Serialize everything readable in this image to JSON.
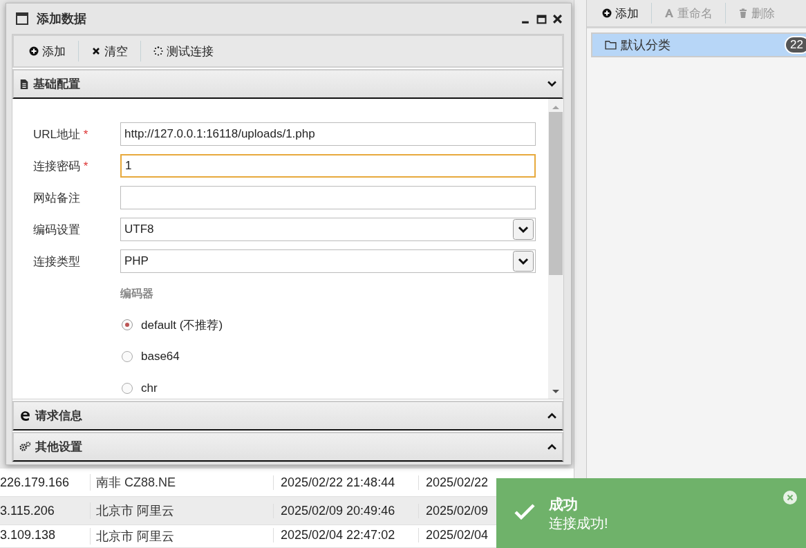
{
  "table": {
    "rows": [
      {
        "ip": "226.179.166",
        "location": "南非 CZ88.NE",
        "created": "2025/02/22 21:48:44",
        "updated": "2025/02/22"
      },
      {
        "ip": "3.115.206",
        "location": "北京市 阿里云",
        "created": "2025/02/09 20:49:46",
        "updated": "2025/02/09"
      },
      {
        "ip": "3.109.138",
        "location": "北京市 阿里云",
        "created": "2025/02/04 22:47:02",
        "updated": "2025/02/04"
      }
    ]
  },
  "sidebar": {
    "toolbar": [
      {
        "label": "添加",
        "disabled": false
      },
      {
        "label": "重命名",
        "disabled": true
      },
      {
        "label": "删除",
        "disabled": true
      }
    ],
    "categories": [
      {
        "label": "默认分类",
        "count": "22",
        "selected": true
      }
    ]
  },
  "dialog": {
    "title": "添加数据",
    "toolbar": [
      {
        "label": "添加"
      },
      {
        "label": "清空"
      },
      {
        "label": "测试连接"
      }
    ],
    "sections": [
      {
        "title": "基础配置",
        "expanded": true
      },
      {
        "title": "请求信息",
        "expanded": false
      },
      {
        "title": "其他设置",
        "expanded": false
      }
    ],
    "fields": [
      {
        "kind": "text",
        "label": "URL地址",
        "required_mark": "*",
        "value": "http://127.0.0.1:16118/uploads/1.php",
        "focused": false
      },
      {
        "kind": "text",
        "label": "连接密码",
        "required_mark": "*",
        "value": "1",
        "focused": true
      },
      {
        "kind": "text",
        "label": "网站备注",
        "focused": false
      },
      {
        "kind": "select",
        "label": "编码设置",
        "value": "UTF8",
        "focused": false
      },
      {
        "kind": "select",
        "label": "连接类型",
        "value": "PHP",
        "focused": false
      }
    ],
    "encoder": {
      "label": "编码器",
      "options": [
        {
          "label": "default (不推荐)",
          "selected": true
        },
        {
          "label": "base64",
          "selected": false
        },
        {
          "label": "chr",
          "selected": false
        }
      ]
    }
  },
  "toast": {
    "title": "成功",
    "message": "连接成功!"
  }
}
